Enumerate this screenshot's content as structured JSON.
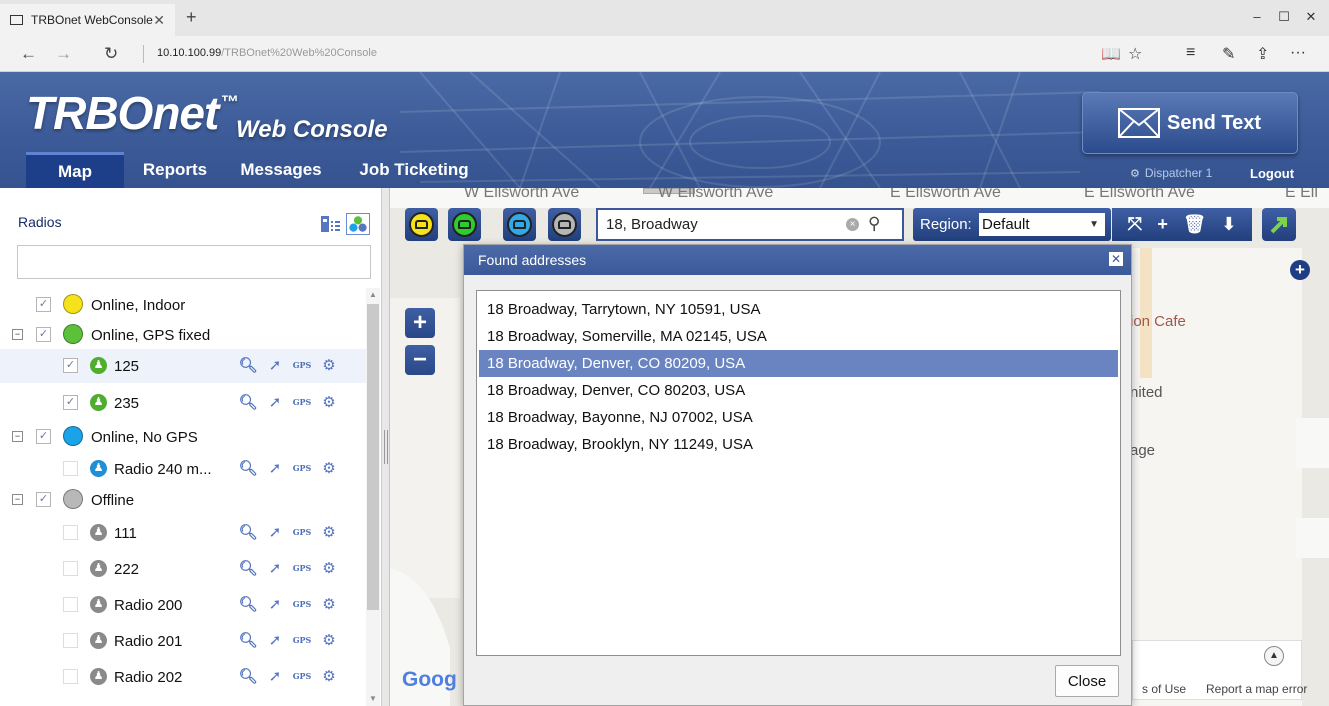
{
  "browser": {
    "tab_title": "TRBOnet WebConsole",
    "tab_close": "✕",
    "new_tab": "+",
    "url_host": "10.10.100.99",
    "url_path": "/TRBOnet%20Web%20Console",
    "nav_back": "←",
    "nav_forward": "→",
    "nav_refresh": "↻",
    "win_min": "–",
    "win_max": "☐",
    "win_close": "✕",
    "reading_icon": "📖",
    "fav_icon": "☆",
    "hub_icon": "≡",
    "notes_icon": "✎",
    "share_icon": "⇪",
    "more_icon": "···"
  },
  "app": {
    "logo": "TRBOnet",
    "logo_tm": "™",
    "logo_sub": "Web Console",
    "menu": [
      "Map",
      "Reports",
      "Messages",
      "Job Ticketing"
    ],
    "send_text": "Send Text",
    "dispatcher": "Dispatcher 1",
    "logout": "Logout"
  },
  "radios": {
    "title": "Radios",
    "filter_value": "",
    "groups": [
      {
        "label": "Online, Indoor",
        "color": "#f5e21b",
        "checked": true
      },
      {
        "label": "Online, GPS fixed",
        "color": "#5cc03a",
        "checked": true
      },
      {
        "label": "Online, No GPS",
        "color": "#1aa3e8",
        "checked": true
      },
      {
        "label": "Offline",
        "color": "#b8b8b8",
        "checked": true
      }
    ],
    "items": [
      {
        "label": "125",
        "color": "#4fae2e"
      },
      {
        "label": "235",
        "color": "#4fae2e"
      },
      {
        "label": "Radio 240 m...",
        "color": "#1f8fd6"
      },
      {
        "label": "111",
        "color": "#8a8a8a"
      },
      {
        "label": "222",
        "color": "#8a8a8a"
      },
      {
        "label": "Radio 200",
        "color": "#8a8a8a"
      },
      {
        "label": "Radio 201",
        "color": "#8a8a8a"
      },
      {
        "label": "Radio 202",
        "color": "#8a8a8a"
      }
    ],
    "gps_label": "GPS"
  },
  "map": {
    "streets": [
      "W Ellsworth Ave",
      "W Ellsworth Ave",
      "E Ellsworth Ave",
      "E Ellsworth Ave",
      "E Ell"
    ],
    "search_value": "18, Broadway",
    "region_label": "Region:",
    "region_value": "Default",
    "poi": [
      "ion Cafe",
      "nited",
      "age"
    ],
    "google": "Goog",
    "terms": "s of Use",
    "report": "Report a map error"
  },
  "dialog": {
    "title": "Found addresses",
    "addresses": [
      "18 Broadway, Tarrytown, NY 10591, USA",
      "18 Broadway, Somerville, MA 02145, USA",
      "18 Broadway, Denver, CO 80209, USA",
      "18 Broadway, Denver, CO 80203, USA",
      "18 Broadway, Bayonne, NJ 07002, USA",
      "18 Broadway, Brooklyn, NY 11249, USA"
    ],
    "selected_index": 2,
    "close_label": "Close"
  },
  "colors": {
    "brand": "#3c5b98",
    "selection": "#6a84c2"
  }
}
